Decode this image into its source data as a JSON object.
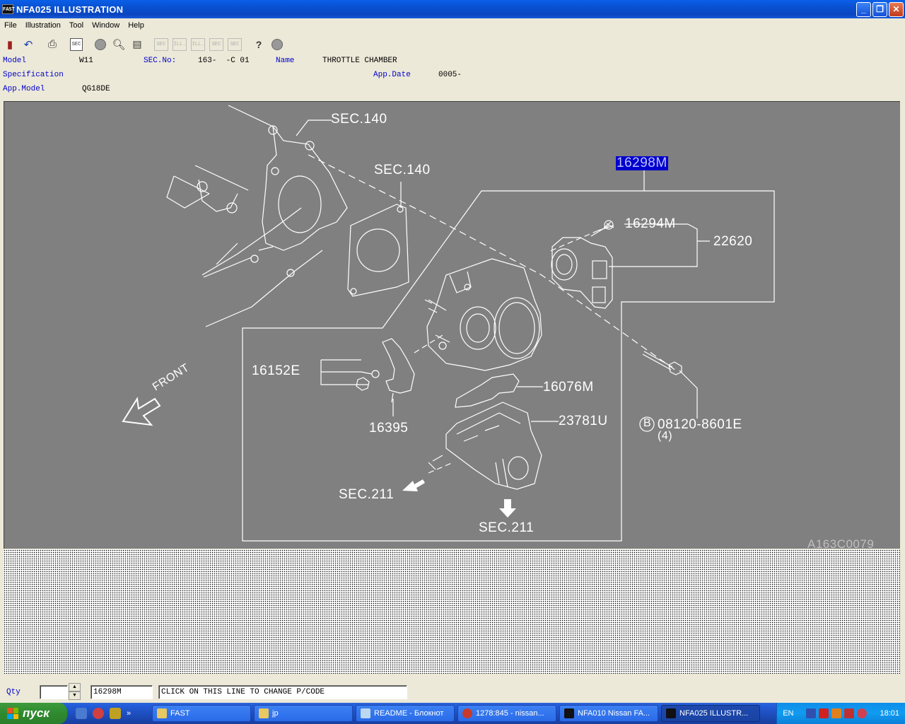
{
  "window": {
    "icon_text": "FAST",
    "title": "NFA025  ILLUSTRATION"
  },
  "menu": [
    "File",
    "Illustration",
    "Tool",
    "Window",
    "Help"
  ],
  "toolbar": {
    "sec_label": "SEC",
    "sec_q_label": "SEC",
    "ill_label": "ILL."
  },
  "info": {
    "model_label": "Model",
    "model_value": "W11",
    "secno_label": "SEC.No:",
    "secno_value": "163-  -C 01",
    "name_label": "Name",
    "name_value": "THROTTLE CHAMBER",
    "spec_label": "Specification",
    "appdate_label": "App.Date",
    "appdate_value": "0005-",
    "appmodel_label": "App.Model",
    "appmodel_value": "QG18DE"
  },
  "diagram": {
    "labels": {
      "sec140_a": "SEC.140",
      "sec140_b": "SEC.140",
      "p16298m": "16298M",
      "p16294m": "16294M",
      "p22620": "22620",
      "p16152e": "16152E",
      "p16076m": "16076M",
      "p23781u": "23781U",
      "p16395": "16395",
      "p08120": "08120-8601E",
      "p08120_qty": "(4)",
      "bolt_mark": "B",
      "sec211_a": "SEC.211",
      "sec211_b": "SEC.211",
      "front": "FRONT",
      "code": "A163C0079"
    }
  },
  "bottom": {
    "qty_label": "Qty",
    "qty_value": "",
    "pcode_value": "16298M",
    "hint": "CLICK ON THIS LINE TO CHANGE P/CODE"
  },
  "taskbar": {
    "start": "пуск",
    "tasks": [
      "FAST",
      "jp",
      "README - Блокнот",
      "1278:845 - nissan...",
      "NFA010 Nissan FA...",
      "NFA025  ILLUSTR..."
    ],
    "lang": "EN",
    "time": "18:01"
  }
}
